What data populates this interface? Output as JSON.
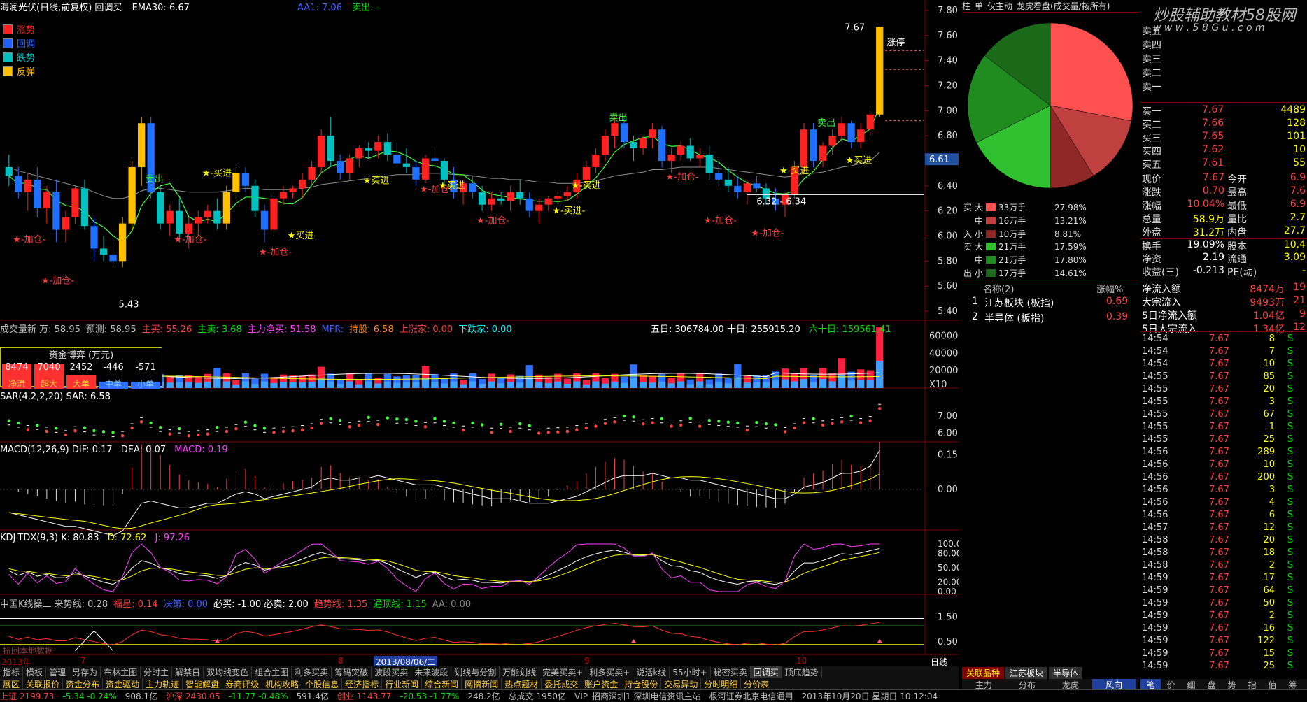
{
  "header": {
    "stock_title": "海润光伏(日线,前复权) 回调买",
    "ema_label": "EMA30: 6.67",
    "aa_label": "AA1: 7.06",
    "sell_label": "卖出: -"
  },
  "legend": [
    {
      "label": "涨势",
      "color": "#ff2020"
    },
    {
      "label": "回调",
      "color": "#2060ff"
    },
    {
      "label": "跌势",
      "color": "#00c0c0"
    },
    {
      "label": "反弹",
      "color": "#ffc000"
    }
  ],
  "main_pane": {
    "y_ticks": [
      "7.80",
      "7.60",
      "7.40",
      "7.20",
      "7.00",
      "6.80",
      "6.60",
      "6.40",
      "6.20",
      "6.00",
      "5.80",
      "5.60",
      "5.40"
    ],
    "current_price": "6.61",
    "high_label": "7.67",
    "low_label": "5.43",
    "range_label": "6.32 - 6.34",
    "limit_up_label": "涨停",
    "annotations": [
      "★-加仓-",
      "★-买进-",
      "卖出",
      "★-买进",
      "★买进"
    ]
  },
  "volume_pane": {
    "title_items": [
      {
        "text": "成交量新 万: 58.95",
        "color": "#c0c0c0"
      },
      {
        "text": "预测: 58.95",
        "color": "#c0c0c0"
      },
      {
        "text": "主买: 55.26",
        "color": "#ff4040"
      },
      {
        "text": "主卖: 3.68",
        "color": "#00e000"
      },
      {
        "text": "主力净买: 51.58",
        "color": "#ff40ff"
      },
      {
        "text": "MFR:",
        "color": "#4060ff"
      },
      {
        "text": "持股: 6.58",
        "color": "#ff8020"
      },
      {
        "text": "上涨家: 0.00",
        "color": "#ff4040"
      },
      {
        "text": "下跌家: 0.00",
        "color": "#00ffff"
      }
    ],
    "summary": "五日: 306784.00  十日: 255915.20",
    "sixty": "六十日: 159561.41",
    "y_ticks": [
      "60000",
      "40000",
      "20000",
      "X10"
    ],
    "fund_box": {
      "title": "资金博弈 (万元)",
      "values": [
        "8474",
        "7040",
        "2452",
        "-446",
        "-571"
      ],
      "labels": [
        "净流",
        "超大",
        "大单",
        "中单",
        "小单"
      ]
    }
  },
  "sar_pane": {
    "title": "SAR(4,2,2,20) SAR: 6.58",
    "y_ticks": [
      "7.00",
      "6.00"
    ]
  },
  "macd_pane": {
    "title_dif": "MACD(12,26,9) DIF: 0.17",
    "title_dea": "DEA: 0.07",
    "title_macd": "MACD: 0.19",
    "y_ticks": [
      "0.15",
      "0.00"
    ]
  },
  "kdj_pane": {
    "title_k": "KDJ-TDX(9,3) K: 80.83",
    "title_d": "D: 72.62",
    "title_j": "J: 97.26",
    "y_ticks": [
      "100.00",
      "80.00",
      "50.00",
      "20.00",
      "0.00"
    ]
  },
  "china_pane": {
    "title_items": [
      {
        "text": "中国K线操二 来势线: 0.28",
        "color": "#c0c0c0"
      },
      {
        "text": "福星: 0.14",
        "color": "#ff4040"
      },
      {
        "text": "决策: 0.00",
        "color": "#4060ff"
      },
      {
        "text": "必买: -1.00 必卖: 2.00",
        "color": "#ffffff"
      },
      {
        "text": "趋势线: 1.35",
        "color": "#ff4040"
      },
      {
        "text": "通顶线: 1.15",
        "color": "#00e000"
      },
      {
        "text": "AA: 0.00",
        "color": "#888888"
      }
    ],
    "y_ticks": [
      "1.50",
      "0.50"
    ],
    "note": "扭回本地数据"
  },
  "time_axis": {
    "labels": [
      "2013年",
      "7",
      "8",
      "2013/08/06/二",
      "9",
      "10"
    ],
    "right_label": "日线"
  },
  "toolbar": {
    "row1": [
      "指标",
      "模板",
      "管理",
      "另存为",
      "布林主图",
      "分时主",
      "解禁日",
      "双均线变色",
      "组合主图",
      "利多买卖",
      "筹码突破",
      "波段买卖",
      "未来波段",
      "划线与分割",
      "万能划线",
      "完美买卖+",
      "利多买卖+",
      "说活k线",
      "55小时+",
      "秘密买卖",
      "回调买",
      "顶底趋势"
    ],
    "row2": [
      "展区",
      "关联报价",
      "资金分布",
      "资金驱动",
      "主力轨迹",
      "智能解盘",
      "券商评级",
      "机构攻略",
      "个股信息",
      "经济指标",
      "行业新闻",
      "综合新闻",
      "网摘新闻",
      "热点题材",
      "委托成交",
      "账户资金",
      "持仓股份",
      "交易异动",
      "分时明细",
      "分价表"
    ],
    "active": "回调买"
  },
  "status_bar": {
    "items": [
      "上证 2199.73",
      "-5.34 -0.24%",
      "908.1亿",
      "沪深 2430.05",
      "-11.77 -0.48%",
      "591.4亿",
      "创业 1143.77",
      "-20.53 -1.77%",
      "248.2亿",
      "总成交 1950亿",
      "VIP_招商深圳1 深圳电信资讯主站",
      "根河证券北京电信通用",
      "2013年10月20日 星期日 10:12:04"
    ]
  },
  "watermark": {
    "line1": "炒股辅助教材58股网",
    "line2": "w w w . 5 8 G u . c o m"
  },
  "pie_panel": {
    "header": [
      "柱",
      "单",
      "仅主动",
      "龙虎看盘(成交量/按所有)"
    ],
    "buy": [
      {
        "size": "大",
        "vol": "33万手",
        "pct": "27.98%",
        "color": "#ff5050"
      },
      {
        "size": "中",
        "vol": "16万手",
        "pct": "13.21%",
        "color": "#c04040"
      },
      {
        "size": "小",
        "vol": "10万手",
        "pct": "8.81%",
        "color": "#902828"
      }
    ],
    "sell": [
      {
        "size": "大",
        "vol": "21万手",
        "pct": "17.59%",
        "color": "#30c030"
      },
      {
        "size": "中",
        "vol": "21万手",
        "pct": "17.80%",
        "color": "#208c20"
      },
      {
        "size": "小",
        "vol": "17万手",
        "pct": "14.61%",
        "color": "#1a6a1a"
      }
    ],
    "buy_tag": [
      "买",
      "入"
    ],
    "sell_tag": [
      "卖",
      "出"
    ]
  },
  "sector_list": {
    "header_name": "名称(2)",
    "header_change": "涨幅%",
    "rows": [
      {
        "idx": "1",
        "name": "江苏板块 (板指)",
        "change": "0.69"
      },
      {
        "idx": "2",
        "name": "半导体 (板指)",
        "change": "0.39"
      }
    ],
    "tabs": [
      "关联品种",
      "江苏板块",
      "半导体"
    ],
    "bottom_tabs": [
      "主力",
      "分布",
      "龙虎",
      "风向"
    ]
  },
  "quote": {
    "sell_levels": [
      "卖五",
      "卖四",
      "卖三",
      "卖二",
      "卖一"
    ],
    "buy_levels": [
      {
        "label": "买一",
        "price": "7.67",
        "vol": "4489"
      },
      {
        "label": "买二",
        "price": "7.66",
        "vol": "128"
      },
      {
        "label": "买三",
        "price": "7.65",
        "vol": "101"
      },
      {
        "label": "买四",
        "price": "7.62",
        "vol": "10"
      },
      {
        "label": "买五",
        "price": "7.61",
        "vol": "55"
      }
    ],
    "stats": [
      {
        "l1": "现价",
        "v1": "7.67",
        "l2": "今开",
        "v2": "6.9"
      },
      {
        "l1": "涨跌",
        "v1": "0.70",
        "l2": "最高",
        "v2": "7.6"
      },
      {
        "l1": "涨幅",
        "v1": "10.04%",
        "l2": "最低",
        "v2": "6.9"
      },
      {
        "l1": "总量",
        "v1": "58.9万",
        "l2": "量比",
        "v2": "2.7"
      },
      {
        "l1": "外盘",
        "v1": "31.2万",
        "l2": "内盘",
        "v2": "27.7"
      },
      {
        "l1": "换手",
        "v1": "19.09%",
        "l2": "股本",
        "v2": "10.4"
      },
      {
        "l1": "净资",
        "v1": "2.19",
        "l2": "流通",
        "v2": "3.09"
      },
      {
        "l1": "收益(三)",
        "v1": "-0.213",
        "l2": "PE(动)",
        "v2": "-"
      }
    ],
    "flows": [
      {
        "label": "净流入额",
        "value": "8474万",
        "extra": "19"
      },
      {
        "label": "大宗流入",
        "value": "9493万",
        "extra": "21"
      },
      {
        "label": "5日净流入额",
        "value": "1.04亿",
        "extra": "9"
      },
      {
        "label": "5日大宗流入",
        "value": "1.34亿",
        "extra": "12"
      }
    ]
  },
  "ticks": [
    {
      "t": "14:54",
      "p": "7.67",
      "v": "8",
      "s": "S"
    },
    {
      "t": "14:54",
      "p": "7.67",
      "v": "7",
      "s": "S"
    },
    {
      "t": "14:54",
      "p": "7.67",
      "v": "10",
      "s": "S"
    },
    {
      "t": "14:55",
      "p": "7.67",
      "v": "85",
      "s": "S"
    },
    {
      "t": "14:55",
      "p": "7.67",
      "v": "20",
      "s": "S"
    },
    {
      "t": "14:55",
      "p": "7.67",
      "v": "3",
      "s": "S"
    },
    {
      "t": "14:55",
      "p": "7.67",
      "v": "67",
      "s": "S"
    },
    {
      "t": "14:55",
      "p": "7.67",
      "v": "1",
      "s": "S"
    },
    {
      "t": "14:55",
      "p": "7.67",
      "v": "25",
      "s": "S"
    },
    {
      "t": "14:56",
      "p": "7.67",
      "v": "289",
      "s": "S"
    },
    {
      "t": "14:56",
      "p": "7.67",
      "v": "10",
      "s": "S"
    },
    {
      "t": "14:56",
      "p": "7.67",
      "v": "200",
      "s": "S"
    },
    {
      "t": "14:56",
      "p": "7.67",
      "v": "3",
      "s": "S"
    },
    {
      "t": "14:56",
      "p": "7.67",
      "v": "4",
      "s": "S"
    },
    {
      "t": "14:56",
      "p": "7.67",
      "v": "6",
      "s": "S"
    },
    {
      "t": "14:57",
      "p": "7.67",
      "v": "12",
      "s": "S"
    },
    {
      "t": "14:58",
      "p": "7.67",
      "v": "20",
      "s": "S"
    },
    {
      "t": "14:58",
      "p": "7.67",
      "v": "18",
      "s": "S"
    },
    {
      "t": "14:58",
      "p": "7.67",
      "v": "2",
      "s": "S"
    },
    {
      "t": "14:59",
      "p": "7.67",
      "v": "17",
      "s": "S"
    },
    {
      "t": "14:59",
      "p": "7.67",
      "v": "64",
      "s": "S"
    },
    {
      "t": "14:59",
      "p": "7.67",
      "v": "50",
      "s": "S"
    },
    {
      "t": "14:59",
      "p": "7.67",
      "v": "2",
      "s": "S"
    },
    {
      "t": "14:59",
      "p": "7.67",
      "v": "16",
      "s": "S"
    },
    {
      "t": "14:59",
      "p": "7.67",
      "v": "122",
      "s": "S"
    },
    {
      "t": "14:59",
      "p": "7.67",
      "v": "15",
      "s": "S"
    },
    {
      "t": "14:59",
      "p": "7.67",
      "v": "25",
      "s": "S"
    }
  ],
  "tick_tabs": [
    "笔",
    "价",
    "细",
    "盘",
    "势",
    "指",
    "值",
    "筹"
  ],
  "chart_data": {
    "type": "candlestick",
    "ylim": [
      5.4,
      7.8
    ],
    "candles": [
      [
        6.55,
        6.65,
        6.4,
        6.48
      ],
      [
        6.48,
        6.55,
        6.3,
        6.35
      ],
      [
        6.35,
        6.5,
        6.2,
        6.45
      ],
      [
        6.45,
        6.55,
        6.15,
        6.22
      ],
      [
        6.22,
        6.4,
        6.1,
        6.35
      ],
      [
        6.35,
        6.45,
        5.95,
        6.05
      ],
      [
        6.05,
        6.2,
        5.95,
        6.15
      ],
      [
        6.15,
        6.4,
        6.1,
        6.38
      ],
      [
        6.38,
        6.45,
        6.05,
        6.08
      ],
      [
        6.08,
        6.15,
        5.8,
        5.9
      ],
      [
        5.9,
        6.0,
        5.8,
        5.85
      ],
      [
        5.85,
        5.95,
        5.75,
        5.8
      ],
      [
        5.8,
        6.15,
        5.75,
        6.1
      ],
      [
        6.1,
        6.6,
        6.05,
        6.55
      ],
      [
        6.55,
        6.95,
        6.4,
        6.9
      ],
      [
        6.9,
        6.95,
        6.3,
        6.35
      ],
      [
        6.35,
        6.4,
        6.05,
        6.1
      ],
      [
        6.1,
        6.25,
        6.0,
        6.2
      ],
      [
        6.2,
        6.3,
        5.95,
        6.02
      ],
      [
        6.02,
        6.15,
        5.9,
        6.1
      ],
      [
        6.1,
        6.2,
        6.0,
        6.15
      ],
      [
        6.15,
        6.25,
        6.1,
        6.2
      ],
      [
        6.2,
        6.3,
        6.05,
        6.1
      ],
      [
        6.1,
        6.4,
        6.05,
        6.35
      ],
      [
        6.35,
        6.55,
        6.3,
        6.5
      ],
      [
        6.5,
        6.55,
        6.35,
        6.4
      ],
      [
        6.4,
        6.45,
        6.15,
        6.2
      ],
      [
        6.2,
        6.25,
        5.95,
        6.05
      ],
      [
        6.05,
        6.35,
        6.0,
        6.3
      ],
      [
        6.3,
        6.4,
        6.25,
        6.35
      ],
      [
        6.35,
        6.4,
        6.3,
        6.38
      ],
      [
        6.38,
        6.5,
        6.3,
        6.45
      ],
      [
        6.45,
        6.6,
        6.4,
        6.55
      ],
      [
        6.55,
        6.85,
        6.5,
        6.8
      ],
      [
        6.8,
        6.95,
        6.55,
        6.6
      ],
      [
        6.6,
        6.65,
        6.45,
        6.5
      ],
      [
        6.5,
        6.65,
        6.45,
        6.62
      ],
      [
        6.62,
        6.72,
        6.55,
        6.7
      ],
      [
        6.7,
        6.75,
        6.62,
        6.68
      ],
      [
        6.68,
        6.8,
        6.62,
        6.75
      ],
      [
        6.75,
        6.82,
        6.6,
        6.65
      ],
      [
        6.65,
        6.75,
        6.55,
        6.58
      ],
      [
        6.58,
        6.7,
        6.5,
        6.55
      ],
      [
        6.55,
        6.6,
        6.4,
        6.45
      ],
      [
        6.45,
        6.65,
        6.42,
        6.62
      ],
      [
        6.62,
        6.72,
        6.55,
        6.6
      ],
      [
        6.6,
        6.62,
        6.4,
        6.45
      ],
      [
        6.45,
        6.55,
        6.3,
        6.35
      ],
      [
        6.35,
        6.45,
        6.25,
        6.42
      ],
      [
        6.42,
        6.48,
        6.3,
        6.35
      ],
      [
        6.35,
        6.4,
        6.2,
        6.25
      ],
      [
        6.25,
        6.35,
        6.2,
        6.3
      ],
      [
        6.3,
        6.35,
        6.25,
        6.28
      ],
      [
        6.28,
        6.4,
        6.2,
        6.35
      ],
      [
        6.35,
        6.45,
        6.25,
        6.3
      ],
      [
        6.3,
        6.35,
        6.15,
        6.2
      ],
      [
        6.2,
        6.3,
        6.1,
        6.25
      ],
      [
        6.25,
        6.32,
        6.2,
        6.3
      ],
      [
        6.3,
        6.35,
        6.25,
        6.32
      ],
      [
        6.32,
        6.4,
        6.28,
        6.35
      ],
      [
        6.35,
        6.5,
        6.3,
        6.45
      ],
      [
        6.45,
        6.6,
        6.4,
        6.55
      ],
      [
        6.55,
        6.7,
        6.5,
        6.65
      ],
      [
        6.65,
        6.85,
        6.6,
        6.8
      ],
      [
        6.8,
        6.95,
        6.7,
        6.9
      ],
      [
        6.9,
        6.95,
        6.7,
        6.75
      ],
      [
        6.75,
        6.8,
        6.6,
        6.7
      ],
      [
        6.7,
        6.8,
        6.65,
        6.78
      ],
      [
        6.78,
        6.9,
        6.7,
        6.85
      ],
      [
        6.85,
        6.88,
        6.55,
        6.6
      ],
      [
        6.6,
        6.7,
        6.5,
        6.65
      ],
      [
        6.65,
        6.75,
        6.6,
        6.72
      ],
      [
        6.72,
        6.78,
        6.6,
        6.62
      ],
      [
        6.62,
        6.7,
        6.55,
        6.65
      ],
      [
        6.65,
        6.72,
        6.45,
        6.5
      ],
      [
        6.5,
        6.6,
        6.4,
        6.45
      ],
      [
        6.45,
        6.55,
        6.35,
        6.4
      ],
      [
        6.4,
        6.48,
        6.3,
        6.35
      ],
      [
        6.35,
        6.45,
        6.25,
        6.42
      ],
      [
        6.42,
        6.48,
        6.35,
        6.38
      ],
      [
        6.38,
        6.42,
        6.25,
        6.3
      ],
      [
        6.3,
        6.38,
        6.2,
        6.25
      ],
      [
        6.25,
        6.35,
        6.15,
        6.33
      ],
      [
        6.33,
        6.6,
        6.3,
        6.55
      ],
      [
        6.55,
        6.9,
        6.5,
        6.85
      ],
      [
        6.85,
        6.9,
        6.55,
        6.6
      ],
      [
        6.6,
        6.75,
        6.55,
        6.72
      ],
      [
        6.72,
        6.85,
        6.65,
        6.8
      ],
      [
        6.8,
        6.95,
        6.75,
        6.9
      ],
      [
        6.9,
        6.92,
        6.7,
        6.75
      ],
      [
        6.75,
        6.9,
        6.7,
        6.85
      ],
      [
        6.85,
        7.0,
        6.8,
        6.97
      ],
      [
        6.97,
        7.67,
        6.95,
        7.67
      ]
    ],
    "ema30": [
      6.55,
      6.52,
      6.5,
      6.48,
      6.46,
      6.44,
      6.42,
      6.4,
      6.38,
      6.35,
      6.32,
      6.3,
      6.3,
      6.32,
      6.36,
      6.38,
      6.38,
      6.37,
      6.36,
      6.35,
      6.35,
      6.35,
      6.35,
      6.36,
      6.37,
      6.38,
      6.38,
      6.37,
      6.37,
      6.37,
      6.37,
      6.38,
      6.39,
      6.41,
      6.42,
      6.43,
      6.44,
      6.45,
      6.46,
      6.47,
      6.48,
      6.49,
      6.49,
      6.49,
      6.5,
      6.5,
      6.5,
      6.49,
      6.49,
      6.48,
      6.47,
      6.46,
      6.46,
      6.45,
      6.45,
      6.44,
      6.43,
      6.43,
      6.42,
      6.42,
      6.42,
      6.43,
      6.44,
      6.46,
      6.48,
      6.49,
      6.5,
      6.51,
      6.53,
      6.53,
      6.54,
      6.55,
      6.55,
      6.55,
      6.55,
      6.54,
      6.53,
      6.52,
      6.51,
      6.5,
      6.49,
      6.48,
      6.47,
      6.48,
      6.5,
      6.5,
      6.51,
      6.53,
      6.55,
      6.56,
      6.58,
      6.6,
      6.67
    ],
    "macd_dif": [
      -0.1,
      -0.11,
      -0.12,
      -0.13,
      -0.14,
      -0.15,
      -0.16,
      -0.16,
      -0.17,
      -0.18,
      -0.19,
      -0.2,
      -0.18,
      -0.12,
      -0.06,
      -0.05,
      -0.06,
      -0.07,
      -0.08,
      -0.08,
      -0.07,
      -0.06,
      -0.06,
      -0.04,
      -0.02,
      -0.01,
      -0.02,
      -0.04,
      -0.03,
      -0.02,
      -0.01,
      0.0,
      0.01,
      0.04,
      0.05,
      0.04,
      0.04,
      0.05,
      0.05,
      0.06,
      0.05,
      0.04,
      0.03,
      0.02,
      0.02,
      0.02,
      0.01,
      0.0,
      -0.01,
      -0.02,
      -0.03,
      -0.04,
      -0.04,
      -0.04,
      -0.05,
      -0.06,
      -0.06,
      -0.06,
      -0.05,
      -0.04,
      -0.03,
      -0.01,
      0.01,
      0.03,
      0.05,
      0.06,
      0.06,
      0.06,
      0.07,
      0.06,
      0.05,
      0.05,
      0.04,
      0.04,
      0.03,
      0.02,
      0.01,
      0.0,
      -0.01,
      -0.02,
      -0.03,
      -0.04,
      -0.04,
      -0.02,
      0.01,
      0.02,
      0.03,
      0.05,
      0.07,
      0.07,
      0.08,
      0.1,
      0.17
    ]
  }
}
